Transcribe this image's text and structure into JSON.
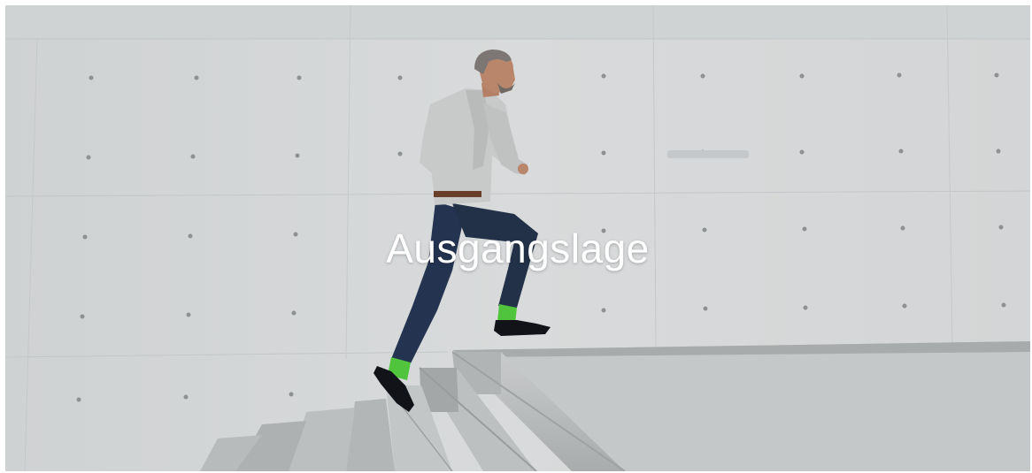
{
  "hero": {
    "title": "Ausgangslage",
    "image_subject": "man-running-up-stairs-photo",
    "colors": {
      "wall": "#d2d4d5",
      "wall_shadow": "#c4c7c9",
      "stairs": "#b9bcbd",
      "stairs_light": "#cfd1d2",
      "jacket": "#c8c9c9",
      "trousers": "#243450",
      "socks": "#4fc43c",
      "shoes": "#111318",
      "skin": "#b9866c",
      "hair": "#7c7774",
      "title_text": "#ffffff"
    }
  }
}
